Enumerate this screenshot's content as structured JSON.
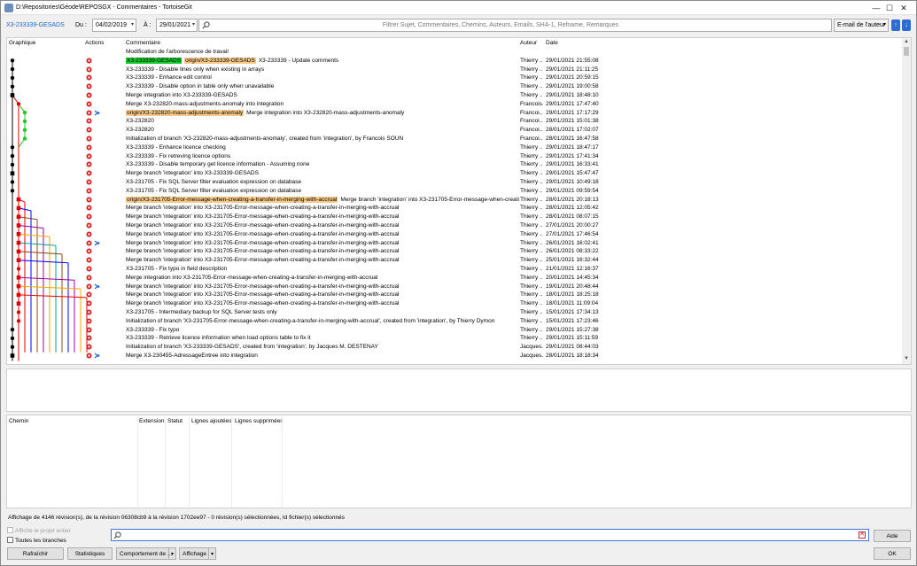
{
  "window": {
    "title": "D:\\Repositories\\Géode\\REPOSGX - Commentaires - TortoiseGit",
    "minimize": "—",
    "maximize": "☐",
    "close": "✕"
  },
  "toolbar": {
    "branch": "X3-233339-GESADS",
    "from_label": "Du :",
    "from_date": "04/02/2019",
    "to_label": "À :",
    "to_date": "29/01/2021",
    "filter_placeholder": "Filtrer Sujet, Commentaires, Chemins, Auteurs, Emails, SHA-1, Refname, Remarques",
    "filter_field": "E-mail de l'auteur",
    "up_arrow": "↑",
    "down_arrow": "↓"
  },
  "log": {
    "headers": {
      "graph": "Graphique",
      "actions": "Actions",
      "comment": "Commentaire",
      "author": "Auteur",
      "date": "Date"
    },
    "rows": [
      {
        "tags": [],
        "comment": "Modification de l'arborescence de travail",
        "author": "",
        "date": ""
      },
      {
        "tags": [
          {
            "text": "X3-233339-GESADS",
            "color": "green"
          },
          {
            "text": "origin/X3-233339-GESADS",
            "color": "orange"
          }
        ],
        "comment": "X3-233339 - Update comments",
        "author": "Thierry ...",
        "date": "29/01/2021 21:55:08"
      },
      {
        "tags": [],
        "comment": "X3-233339 - Disable lines only when existing in arrays",
        "author": "Thierry ...",
        "date": "29/01/2021 21:11:25"
      },
      {
        "tags": [],
        "comment": "X3-233339 - Enhance edit control",
        "author": "Thierry ...",
        "date": "29/01/2021 20:59:15"
      },
      {
        "tags": [],
        "comment": "X3-233339 - Disable option in table only when unavailable",
        "author": "Thierry ...",
        "date": "29/01/2021 19:00:58"
      },
      {
        "tags": [],
        "comment": "Merge integration into X3-233339-GESADS",
        "author": "Thierry ...",
        "date": "29/01/2021 18:48:10"
      },
      {
        "tags": [],
        "comment": "Merge X3-232820-mass-adjustments-anomaly into integration",
        "author": "Francois...",
        "date": "29/01/2021 17:47:40"
      },
      {
        "tags": [
          {
            "text": "origin/X3-232820-mass-adjustments-anomaly",
            "color": "orange"
          }
        ],
        "comment": "Merge integration into X3-232820-mass-adjustments-anomaly",
        "author": "Francoi...",
        "date": "29/01/2021 17:17:29"
      },
      {
        "tags": [],
        "comment": "X3-232820",
        "author": "Francoi...",
        "date": "29/01/2021 15:01:38"
      },
      {
        "tags": [],
        "comment": "X3-232820",
        "author": "Francoi...",
        "date": "28/01/2021 17:02:07"
      },
      {
        "tags": [],
        "comment": "Initialization of branch 'X3-232820-mass-adjustments-anomaly', created from 'integration', by Francois SOUN",
        "author": "Francoi...",
        "date": "28/01/2021 16:47:58"
      },
      {
        "tags": [],
        "comment": "X3-233339 - Enhance licence checking",
        "author": "Thierry ...",
        "date": "29/01/2021 18:47:17"
      },
      {
        "tags": [],
        "comment": "X3-233339 - Fix retreving licence options",
        "author": "Thierry ...",
        "date": "29/01/2021 17:41:34"
      },
      {
        "tags": [],
        "comment": "X3-233339 - Disable temporary get licence information - Assuming none",
        "author": "Thierry ...",
        "date": "29/01/2021 16:33:41"
      },
      {
        "tags": [],
        "comment": "Merge branch 'integration' into X3-233339-GESADS",
        "author": "Thierry ...",
        "date": "29/01/2021 15:47:47"
      },
      {
        "tags": [],
        "comment": "X3-231705 - Fix SQL Server filter evaluation expression on database",
        "author": "Thierry ...",
        "date": "29/01/2021 10:49:18"
      },
      {
        "tags": [],
        "comment": "X3-231705 - Fix SQL Server filter evaluation expression on database",
        "author": "Thierry ...",
        "date": "29/01/2021 09:59:54"
      },
      {
        "tags": [
          {
            "text": "origin/X3-231705-Error-message-when-creating-a-transfer-in-merging-with-accrual",
            "color": "orange"
          }
        ],
        "comment": "Merge branch 'integration' into X3-231705-Error-message-when-creating-a-tr...",
        "author": "Thierry ...",
        "date": "28/01/2021 20:18:13"
      },
      {
        "tags": [],
        "comment": "Merge branch 'integration' into X3-231705-Error-message-when-creating-a-transfer-in-merging-with-accrual",
        "author": "Thierry ...",
        "date": "28/01/2021 12:05:42"
      },
      {
        "tags": [],
        "comment": "Merge branch 'integration' into X3-231705-Error-message-when-creating-a-transfer-in-merging-with-accrual",
        "author": "Thierry ...",
        "date": "28/01/2021 08:07:15"
      },
      {
        "tags": [],
        "comment": "Merge branch 'integration' into X3-231705-Error-message-when-creating-a-transfer-in-merging-with-accrual",
        "author": "Thierry ...",
        "date": "27/01/2021 20:00:27"
      },
      {
        "tags": [],
        "comment": "Merge branch 'integration' into X3-231705-Error-message-when-creating-a-transfer-in-merging-with-accrual",
        "author": "Thierry ...",
        "date": "27/01/2021 17:46:54"
      },
      {
        "tags": [],
        "comment": "Merge branch 'integration' into X3-231705-Error-message-when-creating-a-transfer-in-merging-with-accrual",
        "author": "Thierry ...",
        "date": "26/01/2021 16:02:41"
      },
      {
        "tags": [],
        "comment": "Merge branch 'integration' into X3-231705-Error-message-when-creating-a-transfer-in-merging-with-accrual",
        "author": "Thierry ...",
        "date": "26/01/2021 08:33:22"
      },
      {
        "tags": [],
        "comment": "Merge branch 'integration' into X3-231705-Error-message-when-creating-a-transfer-in-merging-with-accrual",
        "author": "Thierry ...",
        "date": "25/01/2021 16:32:44"
      },
      {
        "tags": [],
        "comment": "X3-231705 - Fix typo in field description",
        "author": "Thierry ...",
        "date": "21/01/2021 12:16:37"
      },
      {
        "tags": [],
        "comment": "Merge integration into X3-231705-Error-message-when-creating-a-transfer-in-merging-with-accrual",
        "author": "Thierry ...",
        "date": "20/01/2021 14:45:34"
      },
      {
        "tags": [],
        "comment": "Merge branch 'integration' into X3-231705-Error-message-when-creating-a-transfer-in-merging-with-accrual",
        "author": "Thierry ...",
        "date": "19/01/2021 20:48:44"
      },
      {
        "tags": [],
        "comment": "Merge branch 'integration' into X3-231705-Error-message-when-creating-a-transfer-in-merging-with-accrual",
        "author": "Thierry ...",
        "date": "18/01/2021 18:25:18"
      },
      {
        "tags": [],
        "comment": "Merge branch 'integration' into X3-231705-Error-message-when-creating-a-transfer-in-merging-with-accrual",
        "author": "Thierry ...",
        "date": "18/01/2021 11:09:04"
      },
      {
        "tags": [],
        "comment": "X3-231705 - Intermediary backup for SQL Server tests only",
        "author": "Thierry ...",
        "date": "15/01/2021 17:34:13"
      },
      {
        "tags": [],
        "comment": "Initialization of branch 'X3-231705-Error-message-when-creating-a-transfer-in-merging-with-accrual', created from 'integration', by Thierry Dymon",
        "author": "Thierry ...",
        "date": "15/01/2021 17:23:46"
      },
      {
        "tags": [],
        "comment": "X3-233339 - Fix typo",
        "author": "Thierry ...",
        "date": "29/01/2021 15:27:38"
      },
      {
        "tags": [],
        "comment": "X3-233339 - Retrieve licence information when load options table to fix it",
        "author": "Thierry ...",
        "date": "29/01/2021 15:11:59"
      },
      {
        "tags": [],
        "comment": "Initialization of branch 'X3-233339-GESADS', created from 'integration', by Jacques M. DESTENAY",
        "author": "Jacques...",
        "date": "29/01/2021 08:44:03"
      },
      {
        "tags": [],
        "comment": "Merge X3-230455-AdressageEntree into integration",
        "author": "Jacques...",
        "date": "28/01/2021 18:18:34"
      }
    ]
  },
  "files": {
    "headers": {
      "path": "Chemin",
      "extension": "Extension",
      "status": "Statut",
      "added": "Lignes ajoutées",
      "removed": "Lignes supprimées"
    }
  },
  "status": {
    "text": "Affichage de 4146 révision(s), de la révision 06308cb9 à la révision 1702ee97 - 0 révision(s) sélectionnées, Id fichier(s) sélectionnés"
  },
  "options": {
    "show_whole_project": "Affiche le projet entier",
    "all_branches": "Toutes les branches"
  },
  "search": {
    "value": "",
    "clear": "✕"
  },
  "buttons": {
    "refresh": "Rafraîchir",
    "statistics": "Statistiques",
    "behavior": "Comportement de ...",
    "display": "Affichage",
    "help": "Aide",
    "ok": "OK"
  },
  "colors": {
    "accent": "#1a6ac9",
    "tag_green": "#18c830",
    "tag_orange": "#f8ca8a",
    "graph_lanes": [
      "#000000",
      "#e00000",
      "#23c823",
      "#0000ff",
      "#8b4513",
      "#a000a0",
      "#ffa500",
      "#00a0a0"
    ]
  }
}
